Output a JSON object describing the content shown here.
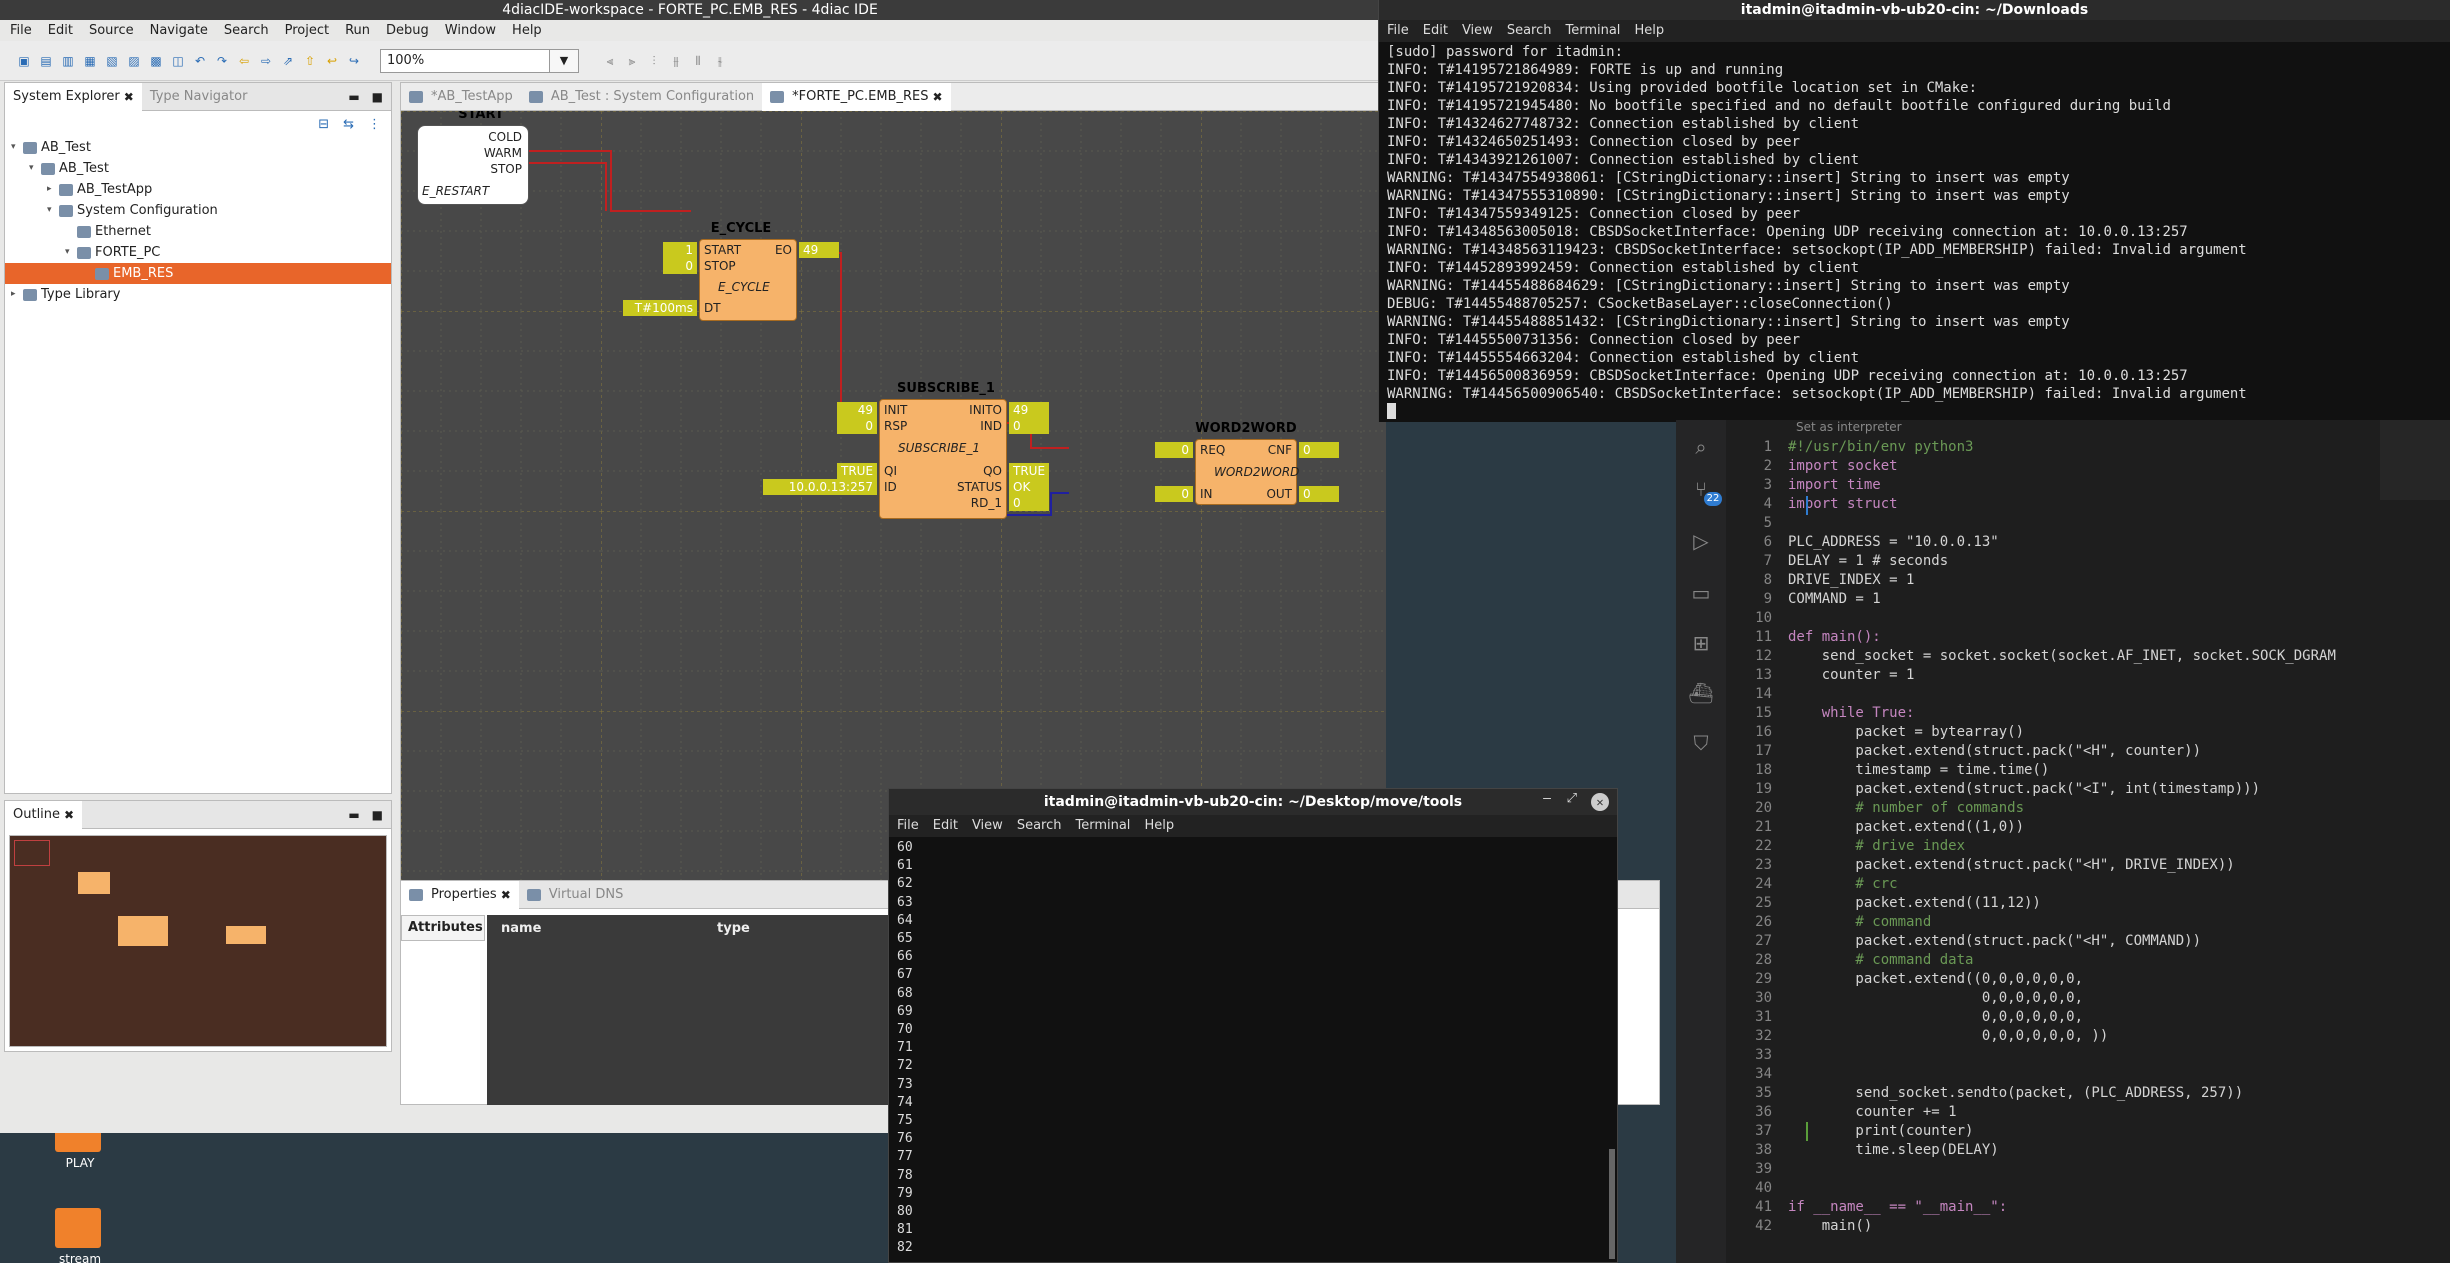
{
  "desktop": {
    "icons": [
      {
        "label": "PLAY"
      },
      {
        "label": "stream"
      }
    ]
  },
  "eclipse": {
    "title": "4diacIDE-workspace - FORTE_PC.EMB_RES - 4diac IDE",
    "menu": [
      "File",
      "Edit",
      "Source",
      "Navigate",
      "Search",
      "Project",
      "Run",
      "Debug",
      "Window",
      "Help"
    ],
    "zoom": "100%",
    "explorer": {
      "tabs": [
        "System Explorer",
        "Type Navigator"
      ],
      "tree": [
        {
          "label": "AB_Test",
          "depth": 0,
          "twisty": "▾"
        },
        {
          "label": "AB_Test",
          "depth": 1,
          "twisty": "▾"
        },
        {
          "label": "AB_TestApp",
          "depth": 2,
          "twisty": "▸"
        },
        {
          "label": "System Configuration",
          "depth": 2,
          "twisty": "▾"
        },
        {
          "label": "Ethernet",
          "depth": 3,
          "twisty": ""
        },
        {
          "label": "FORTE_PC",
          "depth": 3,
          "twisty": "▾"
        },
        {
          "label": "EMB_RES",
          "depth": 4,
          "twisty": "",
          "selected": true
        },
        {
          "label": "Type Library",
          "depth": 0,
          "twisty": "▸"
        }
      ]
    },
    "outline": {
      "tab": "Outline"
    },
    "editor_tabs": [
      "*AB_TestApp",
      "AB_Test : System Configuration",
      "*FORTE_PC.EMB_RES"
    ],
    "fbs": {
      "start": {
        "name": "START",
        "type": "E_RESTART",
        "outputs": [
          "COLD",
          "WARM",
          "STOP"
        ]
      },
      "ecycle": {
        "name": "E_CYCLE",
        "type": "E_CYCLE",
        "inputs": [
          "START",
          "STOP",
          "DT"
        ],
        "outputs": [
          "EO"
        ],
        "in_vals": [
          "1",
          "0",
          "T#100ms"
        ],
        "out_vals": [
          "49"
        ]
      },
      "sub": {
        "name": "SUBSCRIBE_1",
        "type": "SUBSCRIBE_1",
        "inputs": [
          "INIT",
          "RSP",
          "QI",
          "ID"
        ],
        "outputs": [
          "INITO",
          "IND",
          "QO",
          "STATUS",
          "RD_1"
        ],
        "in_vals": [
          "49",
          "0",
          "TRUE",
          "10.0.0.13:257"
        ],
        "out_vals": [
          "49",
          "0",
          "TRUE",
          "OK",
          "0"
        ]
      },
      "w2w": {
        "name": "WORD2WORD",
        "type": "WORD2WORD",
        "inputs": [
          "REQ",
          "IN"
        ],
        "outputs": [
          "CNF",
          "OUT"
        ],
        "in_vals": [
          "0",
          "0"
        ],
        "out_vals": [
          "0",
          "0"
        ]
      }
    },
    "properties": {
      "tabs": [
        "Properties",
        "Virtual DNS"
      ],
      "side_tab": "Attributes",
      "columns": [
        "name",
        "type"
      ]
    }
  },
  "term1": {
    "title": "itadmin@itadmin-vb-ub20-cin: ~/Downloads",
    "menu": [
      "File",
      "Edit",
      "View",
      "Search",
      "Terminal",
      "Help"
    ],
    "lines": [
      "[sudo] password for itadmin:",
      "INFO: T#14195721864989: FORTE is up and running",
      "INFO: T#14195721920834: Using provided bootfile location set in CMake:",
      "INFO: T#14195721945480: No bootfile specified and no default bootfile configured during build",
      "INFO: T#14324627748732: Connection established by client",
      "INFO: T#14324650251493: Connection closed by peer",
      "INFO: T#14343921261007: Connection established by client",
      "WARNING: T#14347554938061: [CStringDictionary::insert] String to insert was empty",
      "WARNING: T#14347555310890: [CStringDictionary::insert] String to insert was empty",
      "INFO: T#14347559349125: Connection closed by peer",
      "INFO: T#14348563005018: CBSDSocketInterface: Opening UDP receiving connection at: 10.0.0.13:257",
      "WARNING: T#14348563119423: CBSDSocketInterface: setsockopt(IP_ADD_MEMBERSHIP) failed: Invalid argument",
      "INFO: T#14452893992459: Connection established by client",
      "WARNING: T#14455488684629: [CStringDictionary::insert] String to insert was empty",
      "DEBUG: T#14455488705257: CSocketBaseLayer::closeConnection()",
      "WARNING: T#14455488851432: [CStringDictionary::insert] String to insert was empty",
      "INFO: T#14455500731356: Connection closed by peer",
      "INFO: T#14455554663204: Connection established by client",
      "INFO: T#14456500836959: CBSDSocketInterface: Opening UDP receiving connection at: 10.0.0.13:257",
      "WARNING: T#14456500906540: CBSDSocketInterface: setsockopt(IP_ADD_MEMBERSHIP) failed: Invalid argument"
    ]
  },
  "term2": {
    "title": "itadmin@itadmin-vb-ub20-cin: ~/Desktop/move/tools",
    "menu": [
      "File",
      "Edit",
      "View",
      "Search",
      "Terminal",
      "Help"
    ],
    "lines": [
      "60",
      "61",
      "62",
      "63",
      "64",
      "65",
      "66",
      "67",
      "68",
      "69",
      "70",
      "71",
      "72",
      "73",
      "74",
      "75",
      "76",
      "77",
      "78",
      "79",
      "80",
      "81",
      "82"
    ]
  },
  "vscode": {
    "hint": "Set as interpreter",
    "badge": "22",
    "code": [
      {
        "n": "1",
        "t": "#!/usr/bin/env python3"
      },
      {
        "n": "2",
        "t": "import socket"
      },
      {
        "n": "3",
        "t": "import time"
      },
      {
        "n": "4",
        "t": "import struct"
      },
      {
        "n": "5",
        "t": ""
      },
      {
        "n": "6",
        "t": "PLC_ADDRESS = \"10.0.0.13\""
      },
      {
        "n": "7",
        "t": "DELAY = 1 # seconds"
      },
      {
        "n": "8",
        "t": "DRIVE_INDEX = 1"
      },
      {
        "n": "9",
        "t": "COMMAND = 1"
      },
      {
        "n": "10",
        "t": ""
      },
      {
        "n": "11",
        "t": "def main():"
      },
      {
        "n": "12",
        "t": "    send_socket = socket.socket(socket.AF_INET, socket.SOCK_DGRAM"
      },
      {
        "n": "13",
        "t": "    counter = 1"
      },
      {
        "n": "14",
        "t": ""
      },
      {
        "n": "15",
        "t": "    while True:"
      },
      {
        "n": "16",
        "t": "        packet = bytearray()"
      },
      {
        "n": "17",
        "t": "        packet.extend(struct.pack(\"<H\", counter))"
      },
      {
        "n": "18",
        "t": "        timestamp = time.time()"
      },
      {
        "n": "19",
        "t": "        packet.extend(struct.pack(\"<I\", int(timestamp)))"
      },
      {
        "n": "20",
        "t": "        # number of commands"
      },
      {
        "n": "21",
        "t": "        packet.extend((1,0))"
      },
      {
        "n": "22",
        "t": "        # drive index"
      },
      {
        "n": "23",
        "t": "        packet.extend(struct.pack(\"<H\", DRIVE_INDEX))"
      },
      {
        "n": "24",
        "t": "        # crc"
      },
      {
        "n": "25",
        "t": "        packet.extend((11,12))"
      },
      {
        "n": "26",
        "t": "        # command"
      },
      {
        "n": "27",
        "t": "        packet.extend(struct.pack(\"<H\", COMMAND))"
      },
      {
        "n": "28",
        "t": "        # command data"
      },
      {
        "n": "29",
        "t": "        packet.extend((0,0,0,0,0,0,"
      },
      {
        "n": "30",
        "t": "                       0,0,0,0,0,0,"
      },
      {
        "n": "31",
        "t": "                       0,0,0,0,0,0,"
      },
      {
        "n": "32",
        "t": "                       0,0,0,0,0,0, ))"
      },
      {
        "n": "33",
        "t": ""
      },
      {
        "n": "34",
        "t": ""
      },
      {
        "n": "35",
        "t": "        send_socket.sendto(packet, (PLC_ADDRESS, 257))"
      },
      {
        "n": "36",
        "t": "        counter += 1"
      },
      {
        "n": "37",
        "t": "        print(counter)"
      },
      {
        "n": "38",
        "t": "        time.sleep(DELAY)"
      },
      {
        "n": "39",
        "t": ""
      },
      {
        "n": "40",
        "t": ""
      },
      {
        "n": "41",
        "t": "if __name__ == \"__main__\":"
      },
      {
        "n": "42",
        "t": "    main()"
      }
    ]
  }
}
